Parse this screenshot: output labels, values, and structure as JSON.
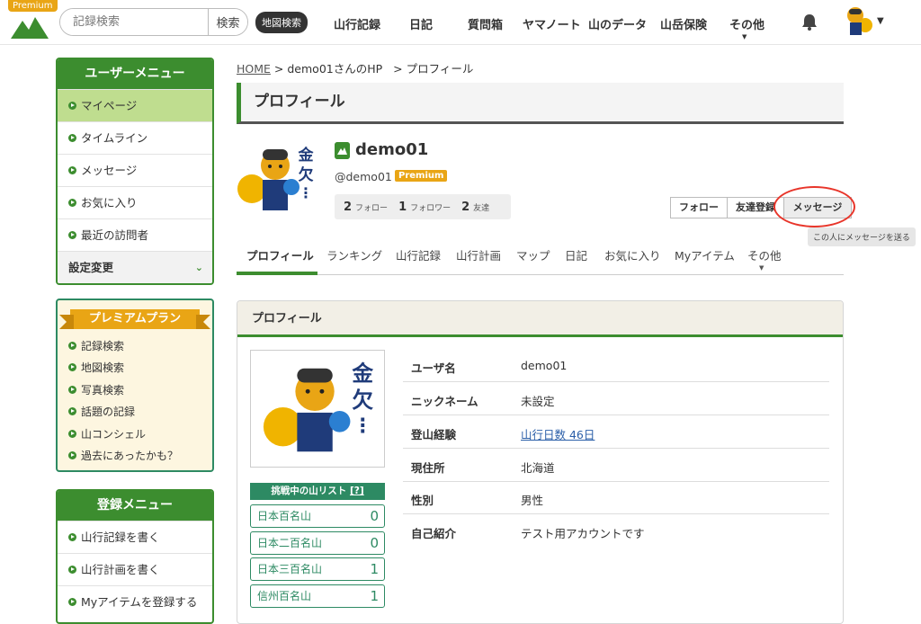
{
  "header": {
    "premium_tag": "Premium",
    "search_placeholder": "記録検索",
    "search_button": "検索",
    "map_search": "地図検索",
    "nav": [
      "山行記録",
      "日記",
      "質問箱",
      "ヤマノート",
      "山のデータ",
      "山岳保険",
      "その他"
    ]
  },
  "sidebar": {
    "user_menu": {
      "title": "ユーザーメニュー",
      "items": [
        "マイページ",
        "タイムライン",
        "メッセージ",
        "お気に入り",
        "最近の訪問者"
      ],
      "settings": "設定変更"
    },
    "premium_plan": {
      "title": "プレミアムプラン",
      "items": [
        "記録検索",
        "地図検索",
        "写真検索",
        "話題の記録",
        "山コンシェル",
        "過去にあったかも？"
      ]
    },
    "register_menu": {
      "title": "登録メニュー",
      "items": [
        "山行記録を書く",
        "山行計画を書く",
        "Myアイテムを登録する"
      ]
    }
  },
  "breadcrumb": {
    "home": "HOME",
    "sep": ">",
    "user_hp": "demo01さんのHP",
    "current": "プロフィール"
  },
  "page_title": "プロフィール",
  "profile": {
    "username": "demo01",
    "handle": "@demo01",
    "premium_badge": "Premium",
    "stats": {
      "follow_count": "2",
      "follow_label": "フォロー",
      "follower_count": "1",
      "follower_label": "フォロワー",
      "friend_count": "2",
      "friend_label": "友達"
    },
    "buttons": {
      "follow": "フォロー",
      "friend": "友達登録",
      "message": "メッセージ"
    },
    "tooltip": "この人にメッセージを送る",
    "avatar_text": "金欠…"
  },
  "tabs": [
    "プロフィール",
    "ランキング",
    "山行記録",
    "山行計画",
    "マップ",
    "日記",
    "お気に入り",
    "Myアイテム",
    "その他"
  ],
  "panel": {
    "title": "プロフィール",
    "challenge": {
      "title": "挑戦中の山リスト",
      "help": "[?]",
      "items": [
        {
          "name": "日本百名山",
          "count": "0"
        },
        {
          "name": "日本二百名山",
          "count": "0"
        },
        {
          "name": "日本三百名山",
          "count": "1"
        },
        {
          "name": "信州百名山",
          "count": "1"
        }
      ]
    },
    "fields": [
      {
        "key": "ユーザ名",
        "value": "demo01"
      },
      {
        "key": "ニックネーム",
        "value": "未設定"
      },
      {
        "key": "登山経験",
        "value": "山行日数 46日"
      },
      {
        "key": "現住所",
        "value": "北海道"
      },
      {
        "key": "性別",
        "value": "男性"
      },
      {
        "key": "自己紹介",
        "value": "テスト用アカウントです"
      }
    ]
  },
  "colors": {
    "brand_green": "#3c8d2f",
    "premium_orange": "#e9a515",
    "highlight_red": "#e8352a"
  }
}
